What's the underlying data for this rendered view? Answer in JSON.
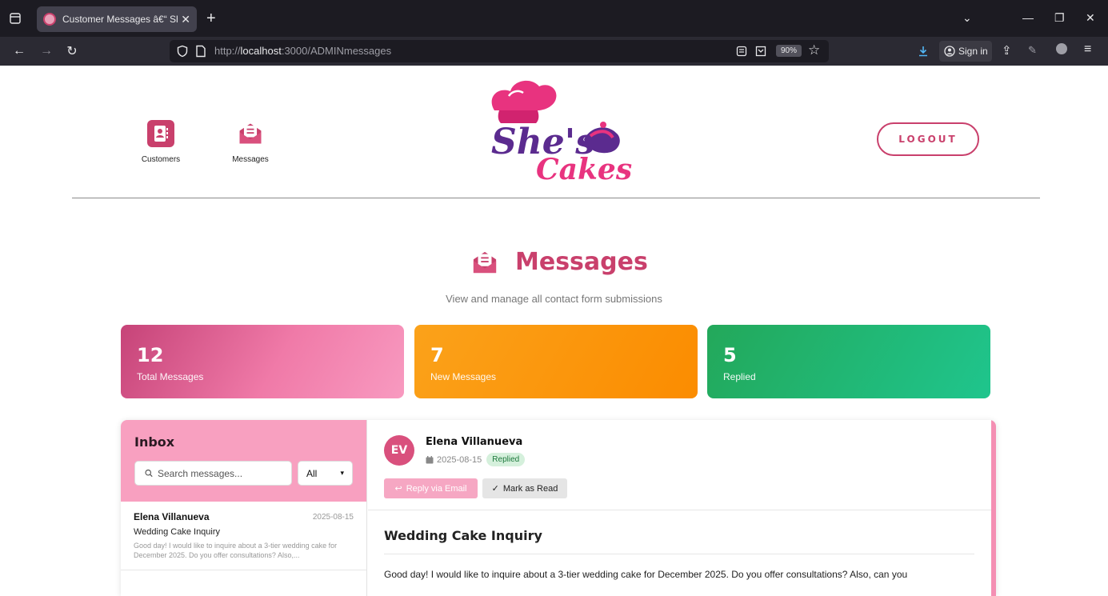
{
  "browser": {
    "tab_title": "Customer Messages â€“ She's Cakes",
    "url_prefix": "http://",
    "url_host": "localhost",
    "url_path": ":3000/ADMINmessages",
    "zoom": "90%",
    "signin_label": "Sign in"
  },
  "header": {
    "nav_items": [
      {
        "label": "Customers"
      },
      {
        "label": "Messages"
      }
    ],
    "logo_line1": "She's",
    "logo_line2": "Cakes",
    "logout_label": "LOGOUT"
  },
  "page": {
    "title": "Messages",
    "subtitle": "View and manage all contact form submissions"
  },
  "stats": [
    {
      "value": "12",
      "label": "Total Messages"
    },
    {
      "value": "7",
      "label": "New Messages"
    },
    {
      "value": "5",
      "label": "Replied"
    }
  ],
  "inbox": {
    "title": "Inbox",
    "search_placeholder": "Search messages...",
    "filter_value": "All",
    "items": [
      {
        "sender": "Elena Villanueva",
        "date": "2025-08-15",
        "subject": "Wedding Cake Inquiry",
        "preview": "Good day! I would like to inquire about a 3-tier wedding cake for December 2025. Do you offer consultations? Also,..."
      }
    ]
  },
  "detail": {
    "initials": "EV",
    "name": "Elena Villanueva",
    "date": "2025-08-15",
    "status": "Replied",
    "reply_label": "Reply via Email",
    "mark_read_label": "Mark as Read",
    "subject": "Wedding Cake Inquiry",
    "body": "Good day! I would like to inquire about a 3-tier wedding cake for December 2025. Do you offer consultations? Also, can you"
  },
  "colors": {
    "brand": "#c9406c",
    "inbox_header": "#f8a0c0",
    "new_orange": "#fb8c00",
    "replied_green": "#23a85a"
  }
}
